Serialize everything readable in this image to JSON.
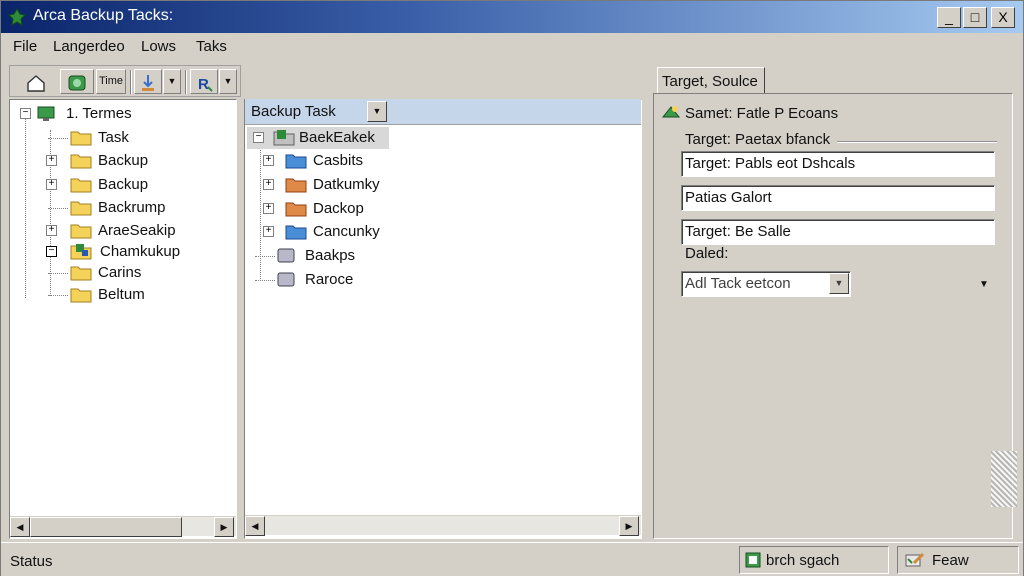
{
  "window": {
    "title": "Arca Backup Tacks:",
    "controls": {
      "minimize": "_",
      "maximize": "□",
      "close": "X"
    }
  },
  "menu": [
    "File",
    "Langerdeo",
    "Lows",
    "Taks"
  ],
  "toolbar": {
    "buttons": [
      {
        "icon": "home-icon"
      },
      {
        "icon": "backup-icon"
      },
      {
        "label": "Time"
      },
      {
        "icon": "download-icon"
      },
      {
        "icon": "dropdown-icon"
      },
      {
        "icon": "restore-icon"
      },
      {
        "icon": "dropdown-icon"
      }
    ]
  },
  "left_tree": {
    "root": "1. Termes",
    "items": [
      "Task",
      "Backup",
      "Backup",
      "Backrump",
      "AraeSeakip",
      "Chamkukup",
      "Carins",
      "Beltum"
    ]
  },
  "middle": {
    "combo_label": "Backup Task",
    "selected": "BaekEakek",
    "items": [
      "Casbits",
      "Datkumky",
      "Dackop",
      "Cancunky"
    ],
    "lower_items": [
      "Baakps",
      "Raroce"
    ]
  },
  "right": {
    "tab": "Target, Soulce",
    "header": "Samet: Fatle P Ecoans",
    "label1": "Target: Paetax bfanck",
    "field1": "Target: Pabls eot Dshcals",
    "field2": "Patias Galort",
    "field3": "Target: Be Salle",
    "label2": "Daled:",
    "select_value": "Adl Tack eetcon"
  },
  "status": {
    "left": "Status",
    "middle": "brch sgach",
    "right": "Feaw"
  },
  "colors": {
    "title_start": "#0a246a",
    "title_end": "#a6caf0",
    "folder": "#f5d35a",
    "folder_blue": "#4a8ed8",
    "folder_orange": "#e08a4a",
    "selection": "#c5d5ea"
  }
}
